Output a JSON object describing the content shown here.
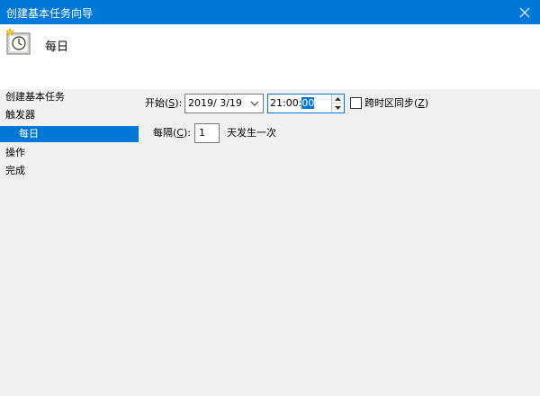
{
  "window": {
    "title": "创建基本任务向导"
  },
  "header": {
    "title": "每日",
    "icon": "calendar-clock-icon"
  },
  "sidebar": {
    "items": [
      {
        "label": "创建基本任务"
      },
      {
        "label": "触发器"
      },
      {
        "label": "每日",
        "selected": true
      },
      {
        "label": "操作"
      },
      {
        "label": "完成"
      }
    ]
  },
  "form": {
    "start_label": "开始",
    "start_hotkey_open": "(",
    "start_hotkey": "S",
    "start_hotkey_close": "):",
    "date_value": "2019/  3/19",
    "time_before": "21:00:",
    "time_selected": "00",
    "sync_label": "跨时区同步",
    "sync_hotkey_open": "(",
    "sync_hotkey": "Z",
    "sync_hotkey_close": ")",
    "sync_checked": false,
    "every_label": "每隔",
    "every_hotkey_open": "(",
    "every_hotkey": "C",
    "every_hotkey_close": "):",
    "every_value": "1",
    "every_suffix": "天发生一次"
  },
  "colors": {
    "accent": "#0078d7",
    "panel": "#f0f0f0",
    "header": "#ffffff"
  }
}
